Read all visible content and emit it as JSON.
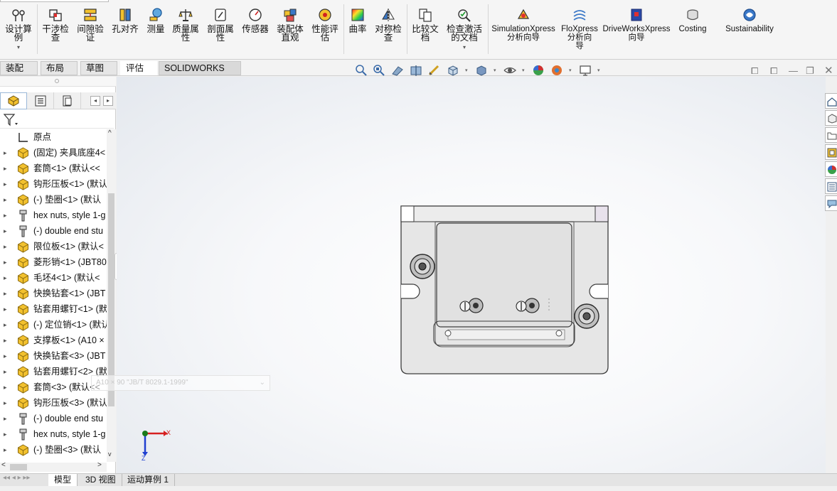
{
  "ribbon": {
    "buttons": [
      {
        "key": "design_study",
        "label": "设计算\n例",
        "has_dropdown": true
      },
      {
        "key": "interference",
        "label": "干涉检\n查"
      },
      {
        "key": "clearance",
        "label": "间隙验\n证"
      },
      {
        "key": "hole_align",
        "label": "孔对齐"
      },
      {
        "key": "measure",
        "label": "测量"
      },
      {
        "key": "mass_props",
        "label": "质量属\n性"
      },
      {
        "key": "section_props",
        "label": "剖面属\n性"
      },
      {
        "key": "sensor",
        "label": "传感器"
      },
      {
        "key": "asm_visualization",
        "label": "装配体\n直观"
      },
      {
        "key": "perf_eval",
        "label": "性能评\n估"
      },
      {
        "key": "curvature",
        "label": "曲率"
      },
      {
        "key": "symmetry",
        "label": "对称检\n查"
      },
      {
        "key": "compare",
        "label": "比较文\n档"
      },
      {
        "key": "check_active",
        "label": "检查激活\n的文档",
        "has_dropdown": true
      },
      {
        "key": "simxpress",
        "label": "SimulationXpress\n分析向导"
      },
      {
        "key": "floxpress",
        "label": "FloXpress\n分析向\n导"
      },
      {
        "key": "driveworks",
        "label": "DriveWorksXpress\n向导"
      },
      {
        "key": "costing",
        "label": "Costing"
      },
      {
        "key": "sustainability",
        "label": "Sustainability"
      }
    ]
  },
  "tabs": [
    {
      "label": "装配体"
    },
    {
      "label": "布局"
    },
    {
      "label": "草图"
    },
    {
      "label": "评估",
      "active": true
    },
    {
      "label": "SOLIDWORKS 插件"
    }
  ],
  "tree": {
    "items": [
      {
        "label": "原点",
        "icon": "origin-icon",
        "expandable": false
      },
      {
        "label": "(固定) 夹具底座4<",
        "icon": "part-icon",
        "expandable": true
      },
      {
        "label": "套筒<1> (默认<<",
        "icon": "part-icon",
        "expandable": true
      },
      {
        "label": "钩形压板<1> (默认",
        "icon": "part-icon",
        "expandable": true
      },
      {
        "label": "(-) 垫圈<1> (默认",
        "icon": "part-icon",
        "expandable": true
      },
      {
        "label": "hex nuts, style 1-g",
        "icon": "toolbox-icon",
        "expandable": true
      },
      {
        "label": "(-) double end stu",
        "icon": "toolbox-icon",
        "expandable": true
      },
      {
        "label": "限位板<1> (默认<",
        "icon": "part-icon",
        "expandable": true
      },
      {
        "label": "菱形销<1> (JBT80",
        "icon": "part-icon",
        "expandable": true
      },
      {
        "label": "毛坯4<1> (默认<",
        "icon": "part-icon",
        "expandable": true
      },
      {
        "label": "快换钻套<1> (JBT",
        "icon": "part-icon",
        "expandable": true
      },
      {
        "label": "钻套用螺钉<1> (默",
        "icon": "part-icon",
        "expandable": true
      },
      {
        "label": "(-) 定位销<1> (默认",
        "icon": "part-icon",
        "expandable": true
      },
      {
        "label": "支撑板<1> (A10 ×",
        "icon": "part-icon",
        "expandable": true
      },
      {
        "label": "快换钻套<3> (JBT",
        "icon": "part-icon",
        "expandable": true
      },
      {
        "label": "钻套用螺钉<2> (默",
        "icon": "part-icon",
        "expandable": true
      },
      {
        "label": "套筒<3> (默认<<",
        "icon": "part-icon",
        "expandable": true
      },
      {
        "label": "钩形压板<3> (默认",
        "icon": "part-icon",
        "expandable": true
      },
      {
        "label": "(-) double end stu",
        "icon": "toolbox-icon",
        "expandable": true
      },
      {
        "label": "hex nuts, style 1-g",
        "icon": "toolbox-icon",
        "expandable": true
      },
      {
        "label": "(-) 垫圈<3> (默认",
        "icon": "part-icon",
        "expandable": true
      }
    ]
  },
  "viewport": {
    "tooltip": "A10 × 90 \"JB/T 8029.1-1999\"",
    "triad": {
      "x_label": "X",
      "z_label": "Z"
    }
  },
  "bottom_tabs": [
    {
      "label": "模型",
      "active": true
    },
    {
      "label": "3D 视图"
    },
    {
      "label": "运动算例 1"
    }
  ],
  "colors": {
    "part_yellow": "#f2c12e",
    "part_outline": "#8a6a10",
    "model_gray": "#e3e3e3",
    "model_edge": "#3c3c3c",
    "triad_x": "#d62020",
    "triad_z": "#2040d0",
    "triad_origin": "#1a7a1a"
  }
}
